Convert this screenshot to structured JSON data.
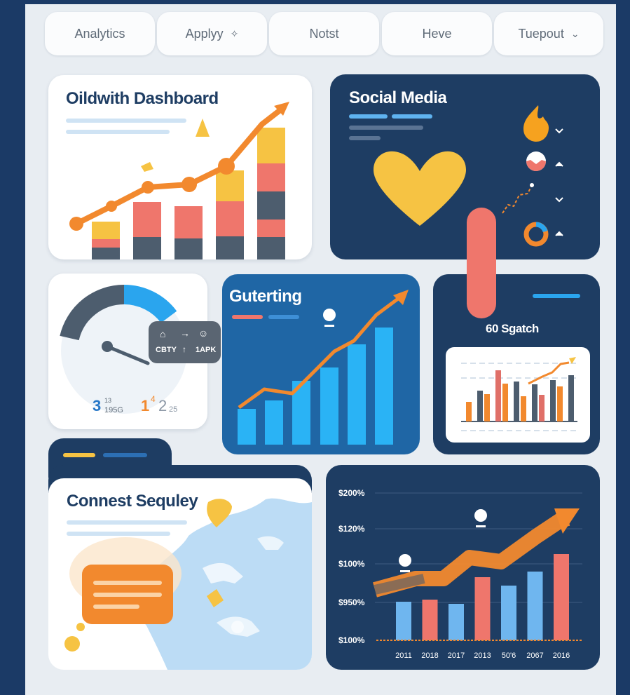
{
  "colors": {
    "navy": "#1b3a66",
    "panel": "#e8edf2",
    "orange": "#f2892e",
    "yellow": "#f6c343",
    "salmon": "#ef766c",
    "slate": "#4d5d6e",
    "sky": "#2aa5ee",
    "lightblue": "#bcdcf5"
  },
  "tabs": [
    {
      "label": "Analytics",
      "icon": ""
    },
    {
      "label": "Applyy",
      "icon": "shuffle-icon"
    },
    {
      "label": "Notst",
      "icon": ""
    },
    {
      "label": "Heve",
      "icon": ""
    },
    {
      "label": "Tuepout",
      "icon": "chevron-down-icon"
    }
  ],
  "cards": {
    "growth": {
      "title": "Oildwith Dashboard"
    },
    "social": {
      "title": "Social Media"
    },
    "gauge": {
      "transfer": {
        "from_label": "CBTY",
        "arrow": "↑",
        "to_label": "1APK",
        "arrow_right": "→"
      },
      "readout_left": {
        "big": "3",
        "small_top": "13",
        "small_bottom": "195G"
      },
      "readout_right": {
        "big": "1",
        "digit_4": "4",
        "digit_2": "2",
        "small": "25"
      }
    },
    "trend": {
      "title": "Guterting"
    },
    "search": {
      "title": "60 Sgatch"
    },
    "region": {
      "title": "Connest Sequley"
    },
    "finance": {
      "y_labels": [
        "$200%",
        "$120%",
        "$100%",
        "$950%",
        "$100%"
      ],
      "x_labels": [
        "2011",
        "2018",
        "2017",
        "2013",
        "50'6",
        "2067",
        "2016"
      ],
      "bar_values": [
        55,
        58,
        52,
        90,
        78,
        98,
        123
      ],
      "bar_colors": [
        "#6fb6ef",
        "#ef766c",
        "#6fb6ef",
        "#ef766c",
        "#6fb6ef",
        "#6fb6ef",
        "#ef766c"
      ]
    }
  }
}
